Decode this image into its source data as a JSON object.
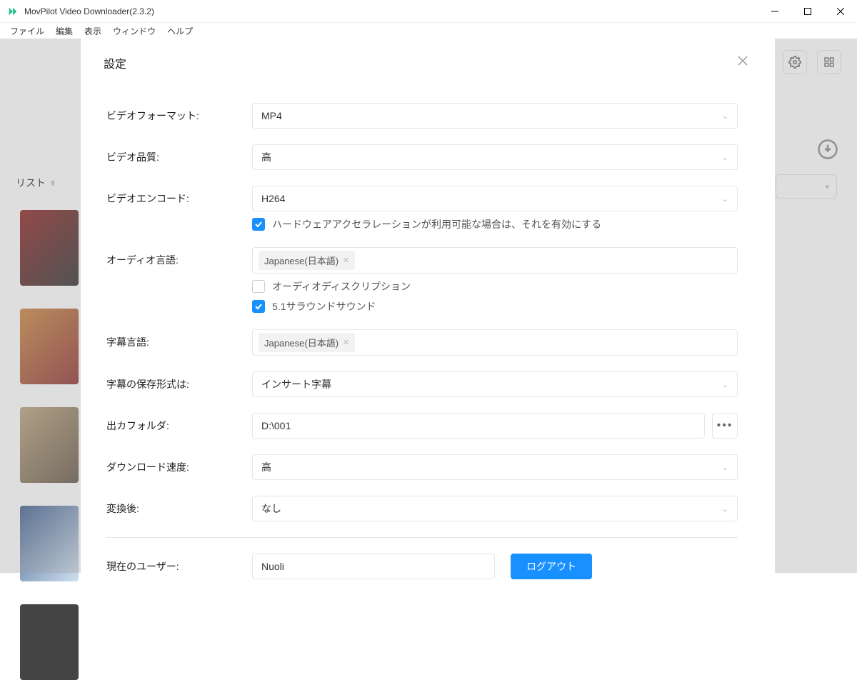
{
  "app": {
    "title": "MovPilot Video Downloader(2.3.2)"
  },
  "menu": {
    "file": "ファイル",
    "edit": "編集",
    "view": "表示",
    "window": "ウィンドウ",
    "help": "ヘルプ"
  },
  "bg": {
    "listLabel": "リスト"
  },
  "modal": {
    "title": "設定",
    "labels": {
      "videoFormat": "ビデオフォーマット:",
      "videoQuality": "ビデオ品質:",
      "videoEncode": "ビデオエンコード:",
      "audioLang": "オーディオ言語:",
      "subtitleLang": "字幕言語:",
      "subtitleSave": "字幕の保存形式は:",
      "outputFolder": "出カフォルダ:",
      "downloadSpeed": "ダウンロード速度:",
      "afterConvert": "変換後:",
      "currentUser": "現在のユーザー:"
    },
    "values": {
      "videoFormat": "MP4",
      "videoQuality": "高",
      "videoEncode": "H264",
      "hwAccelLabel": "ハードウェアアクセラレーションが利用可能な場合は、それを有効にする",
      "audioTag": "Japanese(日本語)",
      "audioDescLabel": "オーディオディスクリプション",
      "surroundLabel": "5.1サラウンドサウンド",
      "subtitleTag": "Japanese(日本語)",
      "subtitleSave": "インサート字幕",
      "outputFolder": "D:\\001",
      "downloadSpeed": "高",
      "afterConvert": "なし",
      "currentUser": "Nuoli",
      "logout": "ログアウト"
    },
    "checks": {
      "hwAccel": true,
      "audioDesc": false,
      "surround": true
    }
  }
}
